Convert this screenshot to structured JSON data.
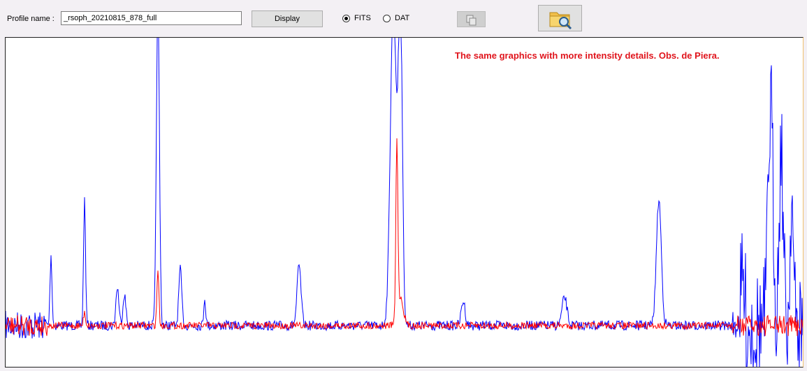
{
  "toolbar": {
    "profile_label": "Profile name :",
    "profile_value": "_rsoph_20210815_878_full",
    "display_label": "Display",
    "radio_fits": "FITS",
    "radio_dat": "DAT",
    "selected_format": "FITS",
    "copy_icon": "copy-icon",
    "folder_icon": "folder-search-icon"
  },
  "chart_data": {
    "type": "line",
    "annotation": "The same graphics with more intensity details. Obs. de Piera.",
    "series": [
      {
        "color": "#0000ff"
      },
      {
        "color": "#ff0000"
      }
    ]
  }
}
